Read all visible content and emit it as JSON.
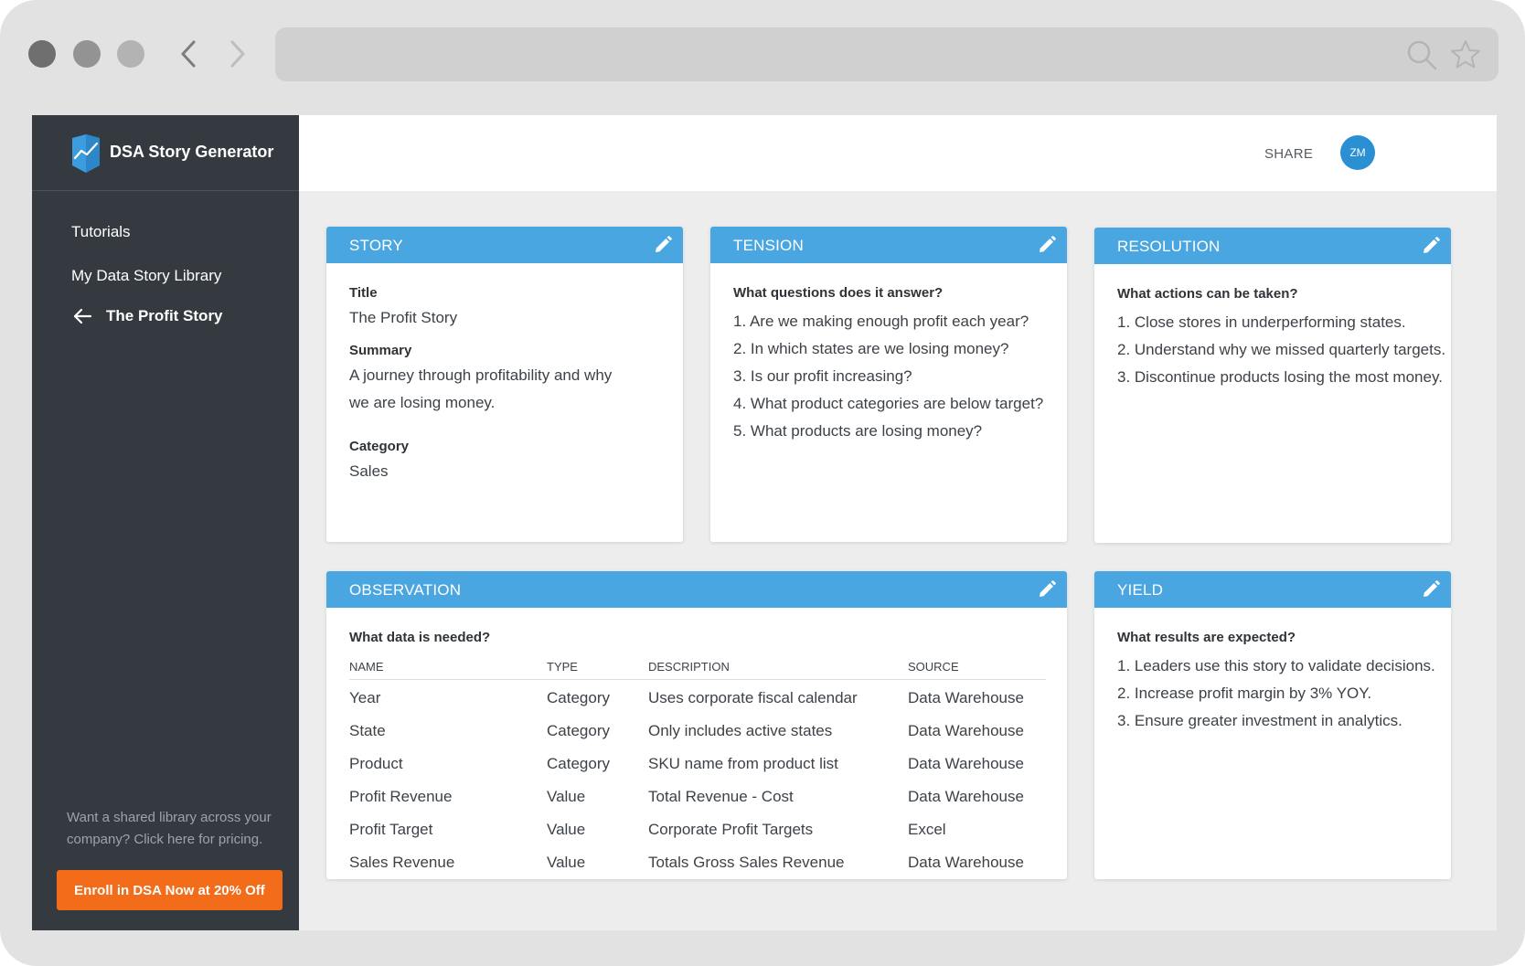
{
  "browser": {
    "address": ""
  },
  "app": {
    "name": "DSA Story Generator"
  },
  "sidebar": {
    "tutorials": "Tutorials",
    "library": "My Data Story Library",
    "current": "The Profit Story",
    "promo": "Want a shared library across your company? Click here for pricing.",
    "cta": "Enroll in DSA Now at 20% Off"
  },
  "header": {
    "share": "SHARE",
    "avatar_initials": "ZM"
  },
  "story": {
    "heading": "STORY",
    "title_label": "Title",
    "title_value": "The Profit Story",
    "summary_label": "Summary",
    "summary_value": "A journey through profitability and why we are losing money.",
    "category_label": "Category",
    "category_value": "Sales"
  },
  "tension": {
    "heading": "TENSION",
    "question": "What questions does it answer?",
    "items": [
      "1. Are we making enough profit each year?",
      "2. In which states are we losing money?",
      "3. Is our profit increasing?",
      "4. What product categories are below target?",
      "5. What products are losing money?"
    ]
  },
  "resolution": {
    "heading": "RESOLUTION",
    "question": "What actions can be taken?",
    "items": [
      "1. Close stores in underperforming states.",
      "2. Understand why we missed quarterly targets.",
      "3. Discontinue products losing the most money."
    ]
  },
  "observation": {
    "heading": "OBSERVATION",
    "question": "What data is needed?",
    "columns": [
      "NAME",
      "TYPE",
      "DESCRIPTION",
      "SOURCE"
    ],
    "rows": [
      [
        "Year",
        "Category",
        "Uses corporate fiscal calendar",
        "Data Warehouse"
      ],
      [
        "State",
        "Category",
        "Only includes active states",
        "Data Warehouse"
      ],
      [
        "Product",
        "Category",
        "SKU name from product list",
        "Data Warehouse"
      ],
      [
        "Profit Revenue",
        "Value",
        "Total Revenue - Cost",
        "Data Warehouse"
      ],
      [
        "Profit Target",
        "Value",
        "Corporate Profit Targets",
        "Excel"
      ],
      [
        "Sales Revenue",
        "Value",
        "Totals Gross Sales Revenue",
        "Data Warehouse"
      ]
    ]
  },
  "yield": {
    "heading": "YIELD",
    "question": "What results are expected?",
    "items": [
      "1. Leaders use this story to validate decisions.",
      "2. Increase profit margin by 3% YOY.",
      "3. Ensure greater investment in analytics."
    ]
  },
  "colors": {
    "sidebar": "#343a40",
    "card_header": "#4aa6e1",
    "cta": "#f26c1a",
    "avatar": "#2a8fd3"
  },
  "icons": [
    "back-arrow-icon",
    "forward-arrow-icon",
    "search-icon",
    "star-icon",
    "logo-icon",
    "arrow-left-icon",
    "pencil-icon"
  ]
}
